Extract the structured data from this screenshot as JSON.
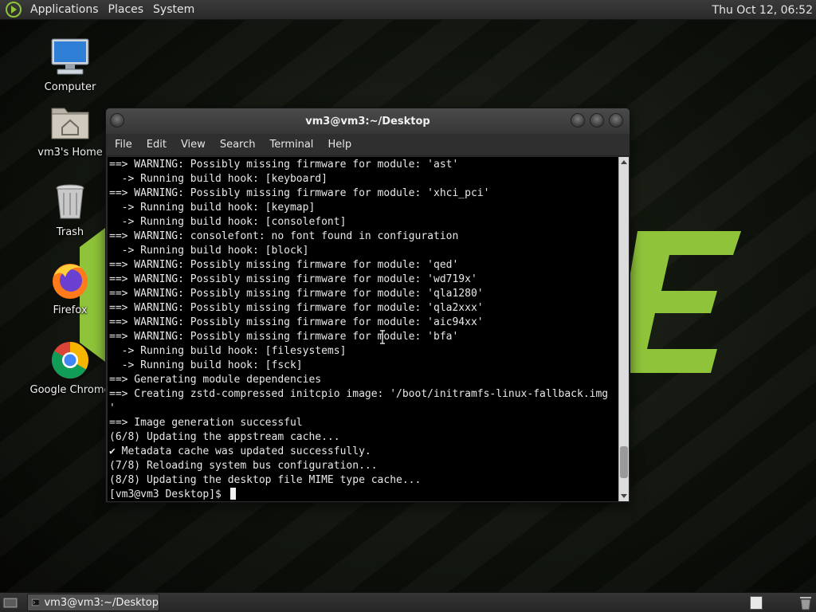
{
  "top_panel": {
    "menu": [
      "Applications",
      "Places",
      "System"
    ],
    "clock": "Thu Oct 12, 06:52"
  },
  "desktop_icons": [
    {
      "label": "Computer",
      "icon": "computer-icon"
    },
    {
      "label": "vm3's Home",
      "icon": "home-folder-icon"
    },
    {
      "label": "Trash",
      "icon": "trash-icon"
    },
    {
      "label": "Firefox",
      "icon": "firefox-icon"
    },
    {
      "label": "Google Chrome",
      "icon": "chrome-icon"
    }
  ],
  "window": {
    "title": "vm3@vm3:~/Desktop",
    "menu": [
      "File",
      "Edit",
      "View",
      "Search",
      "Terminal",
      "Help"
    ],
    "terminal_lines": [
      "==> WARNING: Possibly missing firmware for module: 'ast'",
      "  -> Running build hook: [keyboard]",
      "==> WARNING: Possibly missing firmware for module: 'xhci_pci'",
      "  -> Running build hook: [keymap]",
      "  -> Running build hook: [consolefont]",
      "==> WARNING: consolefont: no font found in configuration",
      "  -> Running build hook: [block]",
      "==> WARNING: Possibly missing firmware for module: 'qed'",
      "==> WARNING: Possibly missing firmware for module: 'wd719x'",
      "==> WARNING: Possibly missing firmware for module: 'qla1280'",
      "==> WARNING: Possibly missing firmware for module: 'qla2xxx'",
      "==> WARNING: Possibly missing firmware for module: 'aic94xx'",
      "==> WARNING: Possibly missing firmware for module: 'bfa'",
      "  -> Running build hook: [filesystems]",
      "  -> Running build hook: [fsck]",
      "==> Generating module dependencies",
      "==> Creating zstd-compressed initcpio image: '/boot/initramfs-linux-fallback.img",
      "'",
      "==> Image generation successful",
      "(6/8) Updating the appstream cache...",
      "✔ Metadata cache was updated successfully.",
      "(7/8) Reloading system bus configuration...",
      "(8/8) Updating the desktop file MIME type cache..."
    ],
    "prompt": "[vm3@vm3 Desktop]$ ",
    "scroll_position": 0.96
  },
  "bottom_panel": {
    "task_label": "vm3@vm3:~/Desktop"
  },
  "colors": {
    "logo_green": "#8fc43a",
    "terminal_bg": "#000000",
    "terminal_fg": "#e8e8e8"
  }
}
